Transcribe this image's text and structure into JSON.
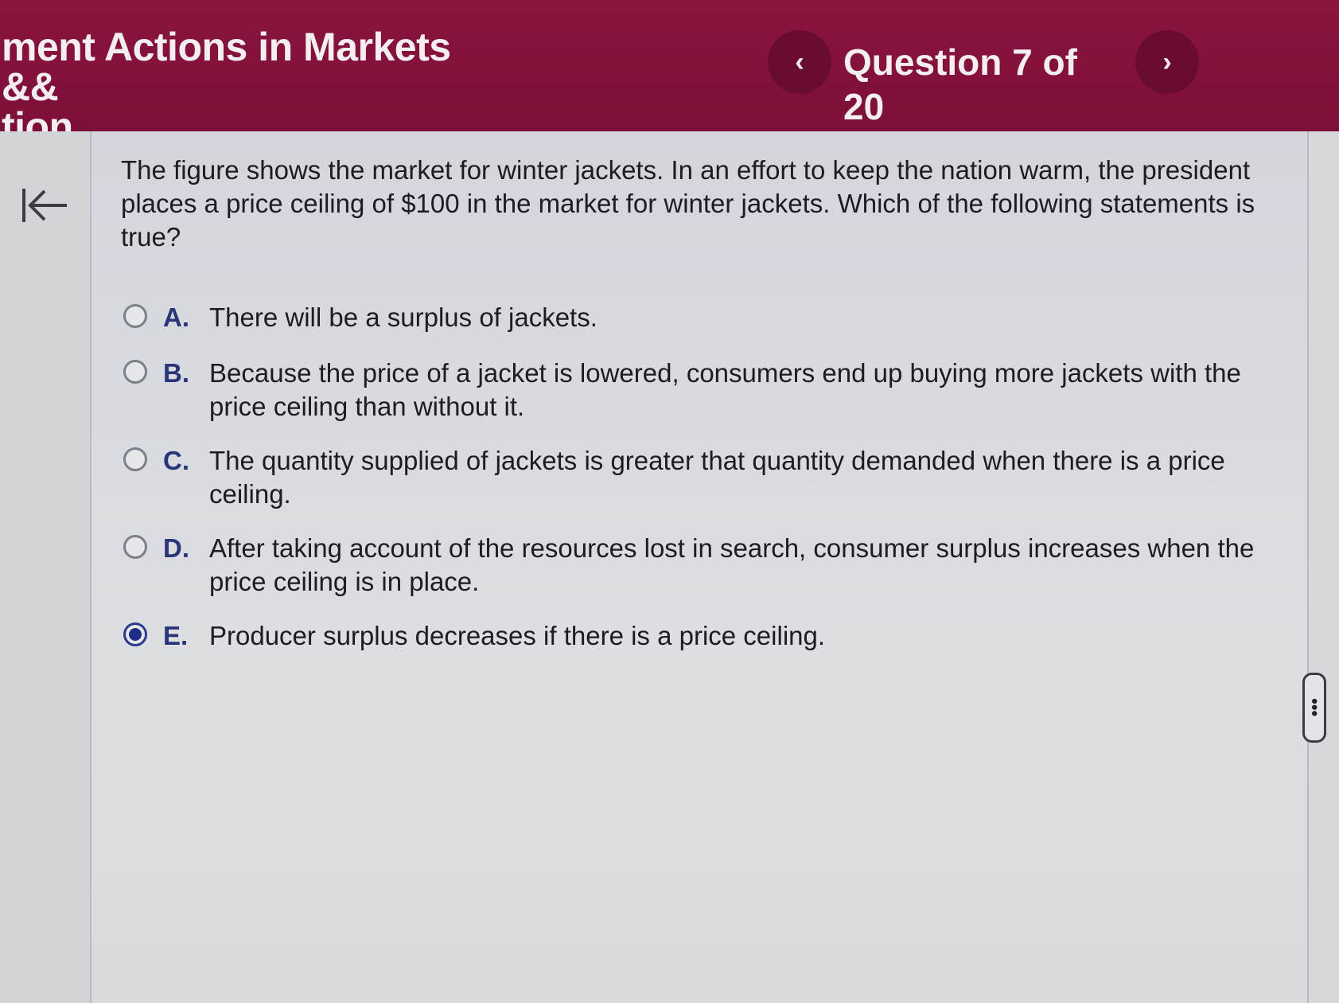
{
  "header": {
    "assignment_title": "ment Actions in Markets &&\ntion",
    "question_counter": "Question 7 of 20",
    "prev_glyph": "‹",
    "next_glyph": "›"
  },
  "question": {
    "text": "The figure shows the market for winter jackets.  In an effort to keep the nation warm, the president places a price ceiling of $100 in the market for winter jackets.  Which of the following statements is true?"
  },
  "options": [
    {
      "letter": "A.",
      "text": "There will be a surplus of jackets.",
      "selected": false
    },
    {
      "letter": "B.",
      "text": "Because the price of a jacket is lowered, consumers end up buying more jackets with the price ceiling than without it.",
      "selected": false
    },
    {
      "letter": "C.",
      "text": "The quantity supplied of jackets is greater that quantity demanded when there is a price ceiling.",
      "selected": false
    },
    {
      "letter": "D.",
      "text": "After taking account of the resources lost in search, consumer surplus increases when the price ceiling is in place.",
      "selected": false
    },
    {
      "letter": "E.",
      "text": "Producer surplus decreases if there is a price ceiling.",
      "selected": true
    }
  ],
  "icons": {
    "collapse": "collapse-left-icon",
    "scroll_handle": "vertical-dots-icon"
  },
  "colors": {
    "header_bg": "#7c0f39",
    "nav_button_bg": "#6a0c31",
    "selected_radio": "#1e2d86"
  }
}
